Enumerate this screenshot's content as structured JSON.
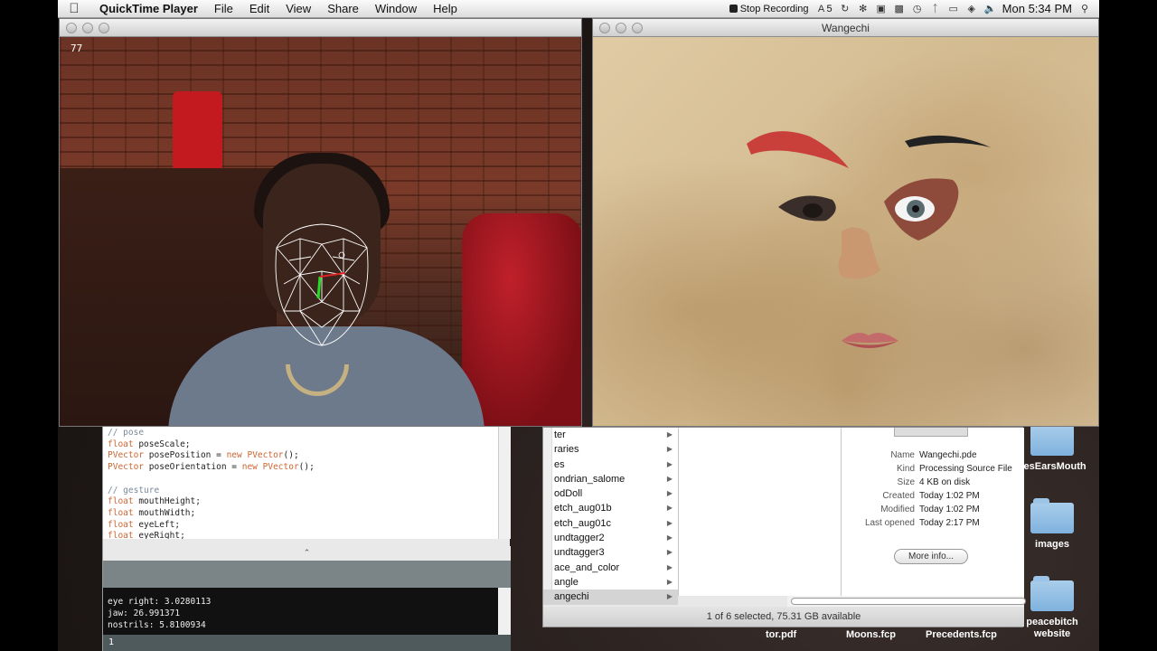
{
  "menubar": {
    "app_name": "QuickTime Player",
    "items": [
      "File",
      "Edit",
      "View",
      "Share",
      "Window",
      "Help"
    ],
    "stop_recording": "Stop Recording",
    "adobe_count": "5",
    "clock": "Mon 5:34 PM"
  },
  "webcam": {
    "fps": "77"
  },
  "face_window": {
    "title": "Wangechi"
  },
  "editor": {
    "code_lines": [
      {
        "cls": "com",
        "text": "// pose"
      },
      {
        "cls": "decl",
        "type": "float",
        "rest": " poseScale;"
      },
      {
        "cls": "decl",
        "type": "PVector",
        "rest": " posePosition = ",
        "kw": "new",
        "rest2": " ",
        "type2": "PVector",
        "rest3": "();"
      },
      {
        "cls": "decl",
        "type": "PVector",
        "rest": " poseOrientation = ",
        "kw": "new",
        "rest2": " ",
        "type2": "PVector",
        "rest3": "();"
      },
      {
        "cls": "blank",
        "text": ""
      },
      {
        "cls": "com",
        "text": "// gesture"
      },
      {
        "cls": "decl",
        "type": "float",
        "rest": " mouthHeight;"
      },
      {
        "cls": "decl",
        "type": "float",
        "rest": " mouthWidth;"
      },
      {
        "cls": "decl",
        "type": "float",
        "rest": " eyeLeft;"
      },
      {
        "cls": "decl",
        "type": "float",
        "rest": " eyeRight;"
      }
    ],
    "console_lines": [
      "eye right: 3.0280113",
      "jaw: 26.991371",
      "nostrils: 5.8100934"
    ],
    "line_number": "1"
  },
  "finder": {
    "col1_items": [
      {
        "label": "ter",
        "arrow": true
      },
      {
        "label": "raries",
        "arrow": true
      },
      {
        "label": "es",
        "arrow": true
      },
      {
        "label": "ondrian_salome",
        "arrow": true
      },
      {
        "label": "odDoll",
        "arrow": true
      },
      {
        "label": "etch_aug01b",
        "arrow": true
      },
      {
        "label": "etch_aug01c",
        "arrow": true
      },
      {
        "label": "undtagger2",
        "arrow": true
      },
      {
        "label": "undtagger3",
        "arrow": true
      },
      {
        "label": "ace_and_color",
        "arrow": true
      },
      {
        "label": "angle",
        "arrow": true
      },
      {
        "label": "angechi",
        "arrow": true,
        "selected": true
      }
    ],
    "info": [
      {
        "key": "Name",
        "value": "Wangechi.pde"
      },
      {
        "key": "Kind",
        "value": "Processing Source File"
      },
      {
        "key": "Size",
        "value": "4 KB on disk"
      },
      {
        "key": "Created",
        "value": "Today 1:02 PM"
      },
      {
        "key": "Modified",
        "value": "Today 1:02 PM"
      },
      {
        "key": "Last opened",
        "value": "Today 2:17 PM"
      }
    ],
    "more_info": "More info...",
    "status": "1 of 6 selected, 75.31 GB available"
  },
  "desktop": {
    "icons": [
      {
        "label": "yesEarsMouth"
      },
      {
        "label": "images"
      },
      {
        "label": "peacebitch website"
      }
    ],
    "files": [
      "tor.pdf",
      "Moons.fcp",
      "Precedents.fcp"
    ]
  }
}
